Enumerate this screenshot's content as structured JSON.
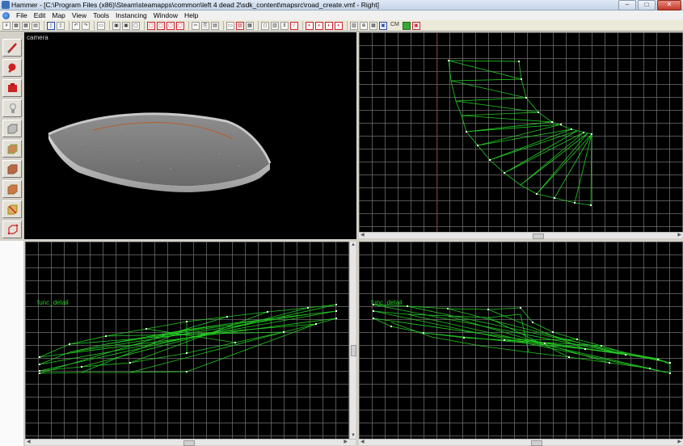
{
  "window": {
    "title": "Hammer - [C:\\Program Files (x86)\\Steam\\steamapps\\common\\left 4 dead 2\\sdk_content\\mapsrc\\road_create.vmf - Right]"
  },
  "menu": [
    "File",
    "Edit",
    "Map",
    "View",
    "Tools",
    "Instancing",
    "Window",
    "Help"
  ],
  "toolbar": {
    "cm_label": "CM"
  },
  "viewports": {
    "camera": {
      "label": "camera"
    },
    "side": {
      "entity_label": "func_detail"
    },
    "front": {
      "entity_label": "func_detail"
    }
  },
  "colors": {
    "wireframe": "#22cc22",
    "vertex": "#ffffff",
    "grid": "#6c6c6c"
  },
  "icons": [
    "app-icon",
    "document-icon",
    "minimize-icon",
    "maximize-icon",
    "close-icon",
    "selection-tool-icon",
    "magnify-tool-icon",
    "camera-tool-icon",
    "entity-tool-icon",
    "block-tool-icon",
    "texture-application-icon",
    "apply-texture-icon",
    "decal-tool-icon",
    "overlay-tool-icon",
    "clipping-tool-icon",
    "vertex-tool-icon"
  ]
}
